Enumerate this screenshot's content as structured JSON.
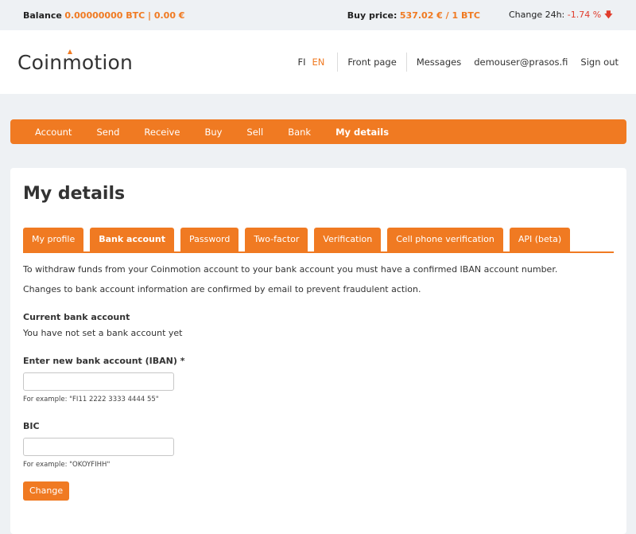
{
  "topbar": {
    "balance_label": "Balance",
    "balance_value": "0.00000000 BTC | 0.00 €",
    "buy_price_label": "Buy price:",
    "buy_price_value": "537.02 € / 1 BTC",
    "change_label": "Change 24h:",
    "change_value": "-1.74 %"
  },
  "header": {
    "logo": "Coinmotion",
    "languages": [
      "FI",
      "EN"
    ],
    "active_language": "EN",
    "links": {
      "front_page": "Front page",
      "messages": "Messages",
      "user": "demouser@prasos.fi",
      "sign_out": "Sign out"
    }
  },
  "mainnav": {
    "items": [
      "Account",
      "Send",
      "Receive",
      "Buy",
      "Sell",
      "Bank",
      "My details"
    ],
    "active": "My details"
  },
  "page": {
    "title": "My details",
    "tabs": [
      "My profile",
      "Bank account",
      "Password",
      "Two-factor",
      "Verification",
      "Cell phone verification",
      "API (beta)"
    ],
    "active_tab": "Bank account",
    "para1": "To withdraw funds from your Coinmotion account to your bank account you must have a confirmed IBAN account number.",
    "para2": "Changes to bank account information are confirmed by email to prevent fraudulent action.",
    "current_label": "Current bank account",
    "current_value": "You have not set a bank account yet",
    "iban_label": "Enter new bank account (IBAN) *",
    "iban_value": "",
    "iban_hint": "For example: \"FI11 2222 3333 4444 55\"",
    "bic_label": "BIC",
    "bic_value": "",
    "bic_hint": "For example: \"OKOYFIHH\"",
    "submit_label": "Change"
  },
  "colors": {
    "accent": "#f07a22",
    "negative": "#e03c2c"
  }
}
